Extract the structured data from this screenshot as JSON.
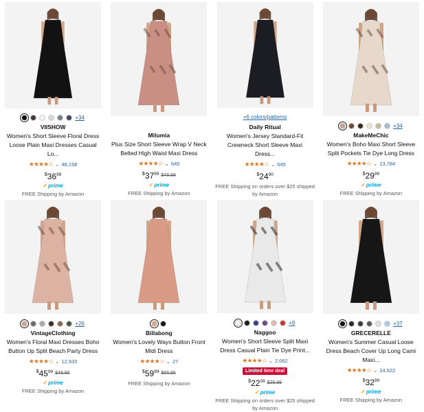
{
  "products": [
    {
      "brand": "VIISHOW",
      "title": "Women's Short Sleeve Floral Dress Loose Plain Maxi Dresses Casual Lo...",
      "rating_count": "48,158",
      "price_sym": "$",
      "price_whole": "36",
      "price_cents": "99",
      "was_price": "",
      "prime": "prime",
      "shipping": "FREE Shipping by Amazon",
      "swatches": [
        "#111111",
        "#4a3a35",
        "#f4f4f4",
        "#d9d9d9",
        "#7a7d84",
        "#3b4a63"
      ],
      "more": "+34",
      "deal": "",
      "patterns": "",
      "dress_color": "#121212"
    },
    {
      "brand": "Milumia",
      "title": "Plus Size Short Sleeve Wrap V Neck Belted High Waist Maxi Dress",
      "rating_count": "645",
      "price_sym": "$",
      "price_whole": "37",
      "price_cents": "99",
      "was_price": "$45.99",
      "prime": "prime",
      "shipping": "FREE Shipping by Amazon",
      "swatches": [],
      "more": "",
      "deal": "",
      "patterns": "",
      "dress_color": "#c98f85"
    },
    {
      "brand": "Daily Ritual",
      "title": "Women's Jersey Standard-Fit Crewneck Short Sleeve Maxi Dress...",
      "rating_count": "545",
      "price_sym": "$",
      "price_whole": "24",
      "price_cents": "90",
      "was_price": "",
      "prime": "",
      "shipping": "FREE Shipping on orders over $25 shipped by Amazon",
      "swatches": [],
      "more": "",
      "deal": "",
      "patterns": "+6 colors/patterns",
      "dress_color": "#1c1d22"
    },
    {
      "brand": "MakeMeChic",
      "title": "Women's Boho Maxi Short Sleeve Split Pockets Tie Dye Long Dress",
      "rating_count": "13,784",
      "price_sym": "$",
      "price_whole": "29",
      "price_cents": "99",
      "was_price": "",
      "prime": "prime",
      "shipping": "FREE Shipping by Amazon",
      "swatches": [
        "#c9a494",
        "#6b4a3a",
        "#3a2a22",
        "#e9e2d6",
        "#c8b89a",
        "#a8b9cc"
      ],
      "more": "+34",
      "deal": "",
      "patterns": "",
      "dress_color": "#e6d9cc"
    },
    {
      "brand": "VintageClothing",
      "title": "Women's Floral Maxi Dresses Boho Button Up Split Beach Party Dress",
      "rating_count": "12,933",
      "price_sym": "$",
      "price_whole": "45",
      "price_cents": "99",
      "was_price": "$48.95",
      "prime": "prime",
      "shipping": "FREE Shipping by Amazon",
      "swatches": [
        "#d8a48f",
        "#6b6b6b",
        "#a9a9a9",
        "#3a2e2a",
        "#8a6d4f",
        "#4d5a3a"
      ],
      "more": "+26",
      "deal": "",
      "patterns": "",
      "dress_color": "#dcb3a3"
    },
    {
      "brand": "Billabong",
      "title": "Women's Lovely Ways Button Front Midi Dress",
      "rating_count": "27",
      "price_sym": "$",
      "price_whole": "59",
      "price_cents": "99",
      "was_price": "$65.95",
      "prime": "",
      "shipping": "FREE Shipping by Amazon",
      "swatches": [
        "#e2a38a",
        "#161616"
      ],
      "more": "",
      "deal": "",
      "patterns": "",
      "dress_color": "#d99a86"
    },
    {
      "brand": "Naggoo",
      "title": "Women's Short Sleeve Split Maxi Dress Casual Plain Tie Dye Print...",
      "rating_count": "2,062",
      "price_sym": "$",
      "price_whole": "22",
      "price_cents": "09",
      "was_price": "$25.99",
      "prime": "prime",
      "shipping": "FREE Shipping on orders over $25 shipped by Amazon",
      "swatches": [
        "#f1f1f1",
        "#1c1c1c",
        "#3b3f8a",
        "#6a4a8c",
        "#e0b9b0",
        "#c43b3b"
      ],
      "more": "+9",
      "deal": "Limited time deal",
      "patterns": "",
      "dress_color": "#e9e9e9"
    },
    {
      "brand": "GRECERELLE",
      "title": "Women's Summer Casual Loose Dress Beach Cover Up Long Cami Maxi...",
      "rating_count": "14,922",
      "price_sym": "$",
      "price_whole": "32",
      "price_cents": "99",
      "was_price": "",
      "prime": "prime",
      "shipping": "FREE Shipping by Amazon",
      "swatches": [
        "#141414",
        "#2a2a2a",
        "#3a3a3a",
        "#5a5a5a",
        "#e0e0e0",
        "#aecbe6"
      ],
      "more": "+37",
      "deal": "",
      "patterns": "",
      "dress_color": "#161616"
    }
  ]
}
